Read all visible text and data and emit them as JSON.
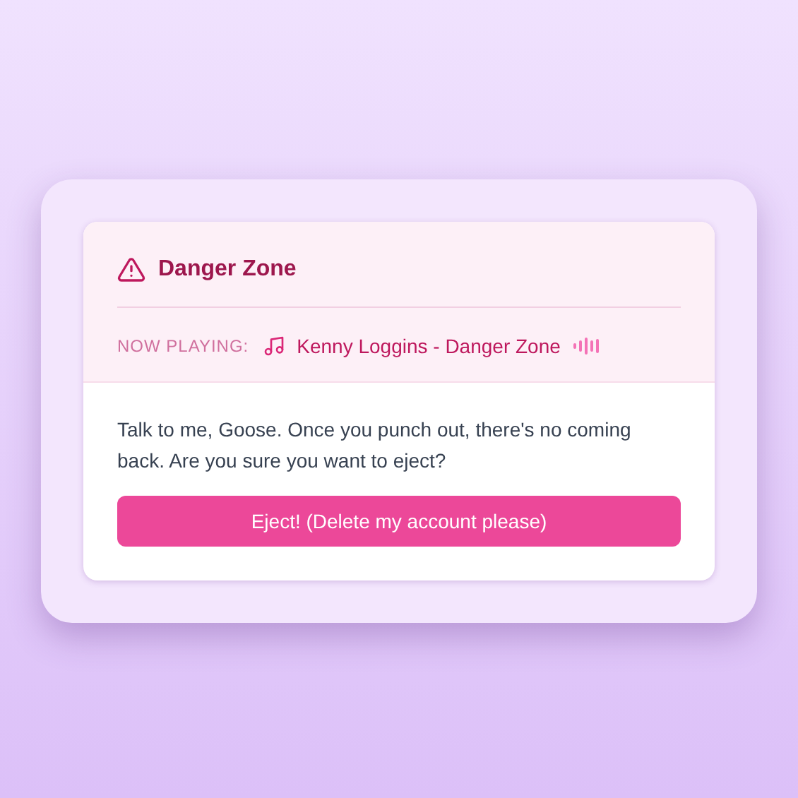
{
  "dialog": {
    "title": "Danger Zone",
    "now_playing_label": "NOW PLAYING:",
    "track": "Kenny Loggins - Danger Zone",
    "message": "Talk to me, Goose. Once you punch out, there's no coming back. Are you sure you want to eject?",
    "confirm_button": "Eject! (Delete my account please)"
  }
}
